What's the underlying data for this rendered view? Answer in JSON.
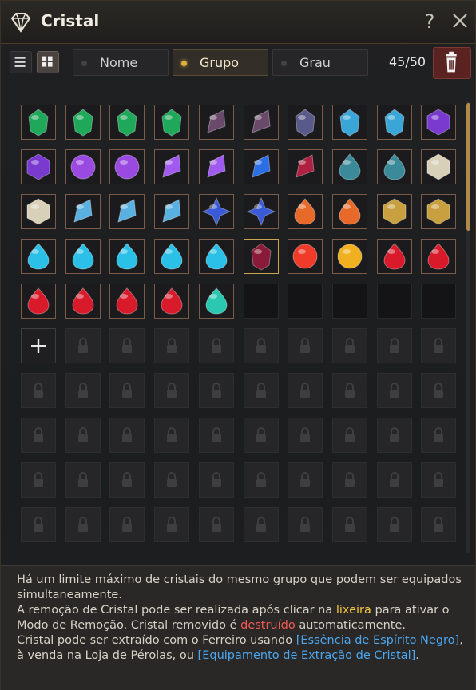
{
  "window": {
    "title": "Cristal",
    "help_label": "?"
  },
  "toolbar": {
    "tabs": [
      {
        "label": "Nome",
        "active": false
      },
      {
        "label": "Grupo",
        "active": true
      },
      {
        "label": "Grau",
        "active": false
      }
    ],
    "count": "45/50"
  },
  "grid": {
    "columns": 10,
    "rows": [
      [
        "green-gem",
        "green-gem",
        "green-gem",
        "green-gem",
        "dark-shard",
        "dark-shard",
        "dark-stone",
        "blue-green-gem",
        "blue-green-gem",
        "violet-hex"
      ],
      [
        "violet-hex",
        "violet-orb",
        "violet-orb",
        "violet-crystal",
        "violet-crystal",
        "blue-flame-shard",
        "crimson-shard",
        "teal-drop",
        "teal-drop",
        "silver-hex"
      ],
      [
        "silver-hex",
        "ice-shard",
        "ice-shard",
        "ice-shard",
        "blue-star",
        "blue-star",
        "amber-drop",
        "amber-drop",
        "gold-rune",
        "gold-rune"
      ],
      [
        "cyan-drop",
        "cyan-drop",
        "cyan-drop",
        "cyan-drop",
        "cyan-drop",
        "ruby-chunk",
        "red-orb",
        "gold-orb",
        "red-gem",
        "red-gem"
      ],
      [
        "red-gem",
        "red-gem",
        "red-gem",
        "red-gem",
        "teal-gem",
        "empty",
        "empty",
        "empty",
        "empty",
        "empty"
      ],
      [
        "add",
        "locked",
        "locked",
        "locked",
        "locked",
        "locked",
        "locked",
        "locked",
        "locked",
        "locked"
      ],
      [
        "locked",
        "locked",
        "locked",
        "locked",
        "locked",
        "locked",
        "locked",
        "locked",
        "locked",
        "locked"
      ],
      [
        "locked",
        "locked",
        "locked",
        "locked",
        "locked",
        "locked",
        "locked",
        "locked",
        "locked",
        "locked"
      ],
      [
        "locked",
        "locked",
        "locked",
        "locked",
        "locked",
        "locked",
        "locked",
        "locked",
        "locked",
        "locked"
      ],
      [
        "locked",
        "locked",
        "locked",
        "locked",
        "locked",
        "locked",
        "locked",
        "locked",
        "locked",
        "locked"
      ]
    ],
    "gem_colors": {
      "green-gem": "#1fa85a",
      "dark-shard": "#6a4a6a",
      "dark-stone": "#5a5a8a",
      "blue-green-gem": "#3aa6d8",
      "violet-hex": "#7a3ad0",
      "violet-orb": "#9a4ae0",
      "violet-crystal": "#a05af0",
      "blue-flame-shard": "#2a6ee8",
      "crimson-shard": "#b02040",
      "teal-drop": "#3a8a9a",
      "silver-hex": "#d8d0b8",
      "ice-shard": "#5ab0e0",
      "blue-star": "#3a5ad8",
      "amber-drop": "#e86a2a",
      "gold-rune": "#c8a040",
      "cyan-drop": "#2ac0e8",
      "ruby-chunk": "#8a1a3a",
      "red-orb": "#f03a2a",
      "gold-orb": "#f0b020",
      "red-gem": "#d81a2a",
      "teal-gem": "#2ac8b0"
    }
  },
  "info": {
    "line1": "Há um limite máximo de cristais do mesmo grupo que podem ser equipados simultaneamente.",
    "line2_a": "A remoção de Cristal pode ser realizada após clicar na ",
    "line2_b": "lixeira",
    "line2_c": " para ativar o Modo de Remoção. Cristal removido é ",
    "line2_d": "destruído",
    "line2_e": " automaticamente.",
    "line3_a": "Cristal pode ser extraído com o Ferreiro usando ",
    "line3_b": "[Essência de Espírito Negro]",
    "line3_c": ", à venda na Loja de Pérolas, ou ",
    "line3_d": "[Equipamento de Extração de Cristal]",
    "line3_e": "."
  },
  "colors": {
    "accent_gold": "#e0b040",
    "trash_red": "#5a2322"
  }
}
